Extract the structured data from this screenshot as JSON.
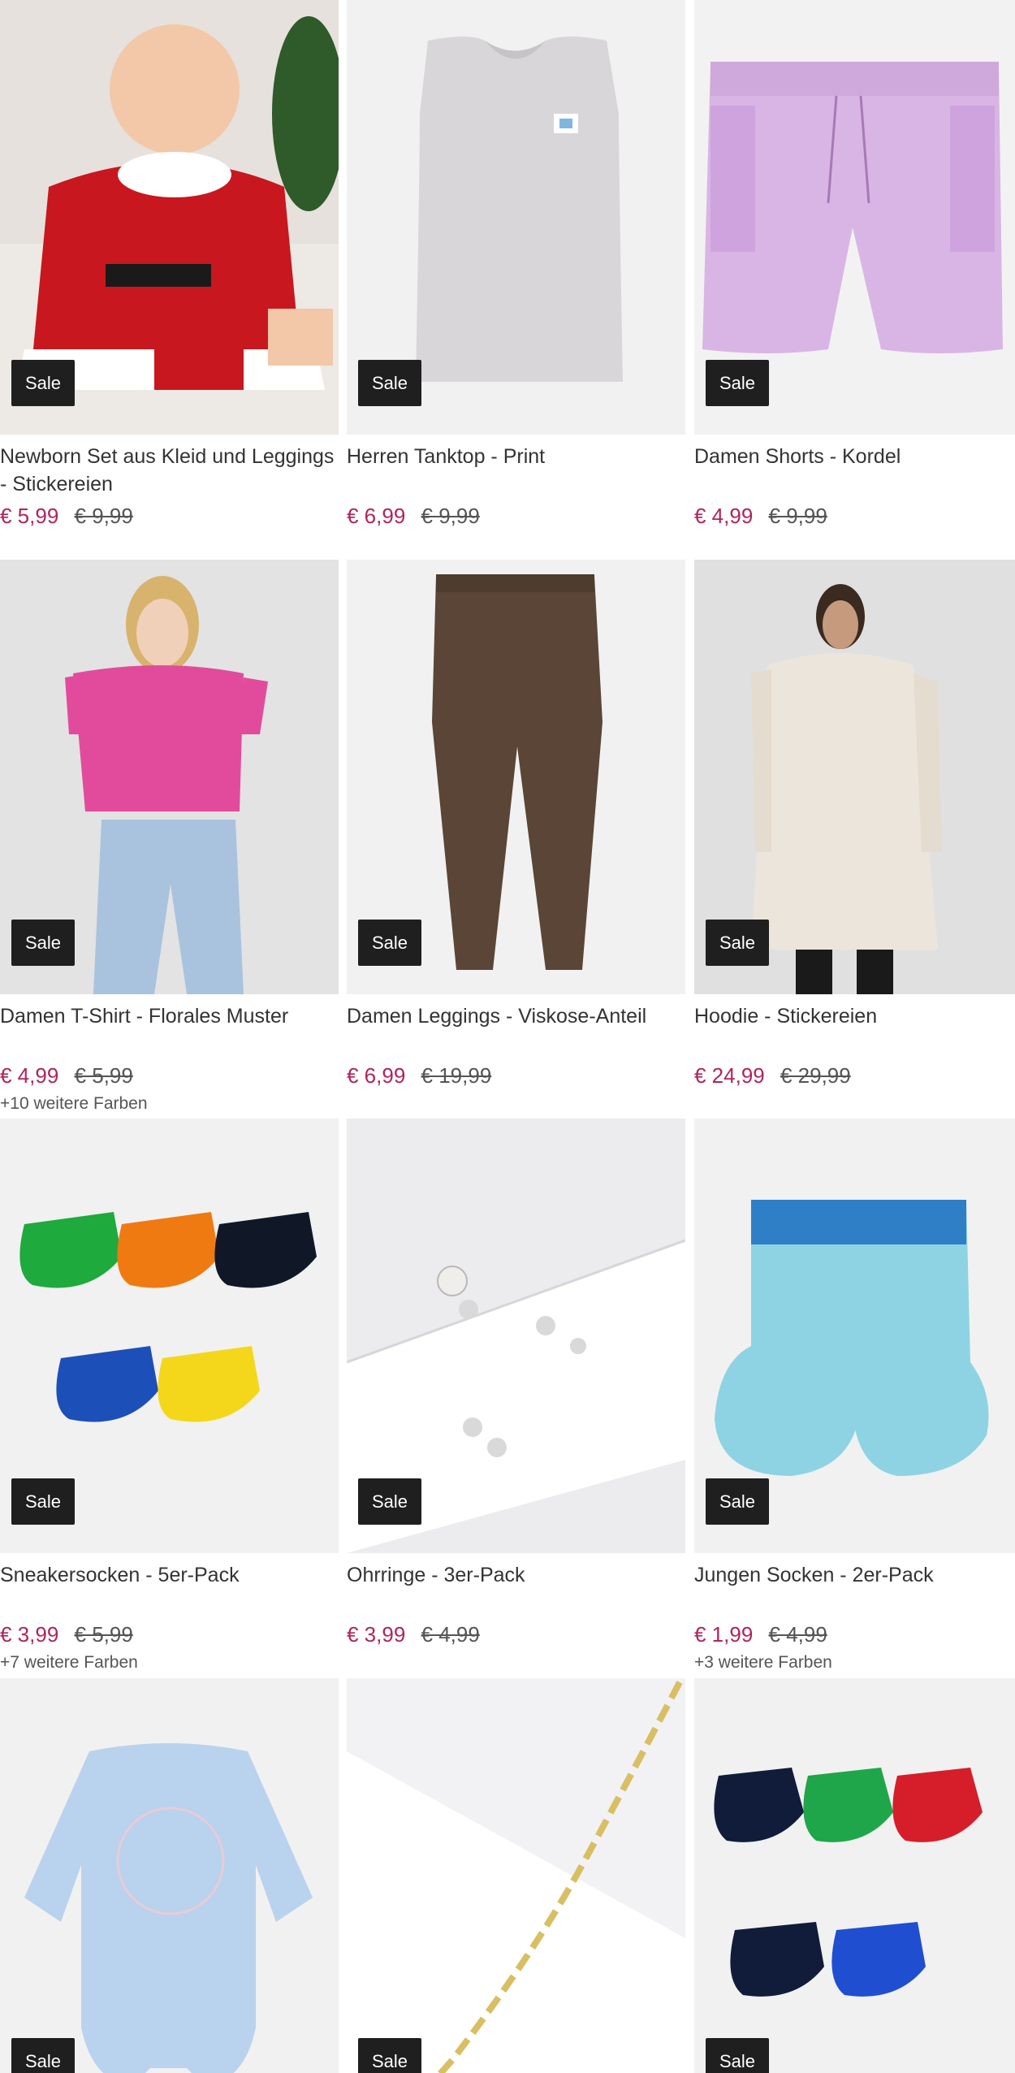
{
  "badge_label": "Sale",
  "colors": {
    "price_sale": "#b0245d",
    "badge_bg": "#1f1f1f"
  },
  "products": [
    {
      "title": "Newborn Set aus Kleid und Leggings - Stickereien",
      "price": "€ 5,99",
      "old_price": "€ 9,99",
      "more_colors": ""
    },
    {
      "title": "Herren Tanktop - Print",
      "price": "€ 6,99",
      "old_price": "€ 9,99",
      "more_colors": ""
    },
    {
      "title": "Damen Shorts - Kordel",
      "price": "€ 4,99",
      "old_price": "€ 9,99",
      "more_colors": ""
    },
    {
      "title": "Damen T-Shirt - Florales Muster",
      "price": "€ 4,99",
      "old_price": "€ 5,99",
      "more_colors": "+10 weitere Farben"
    },
    {
      "title": "Damen Leggings - Viskose-Anteil",
      "price": "€ 6,99",
      "old_price": "€ 19,99",
      "more_colors": ""
    },
    {
      "title": "Hoodie - Stickereien",
      "price": "€ 24,99",
      "old_price": "€ 29,99",
      "more_colors": ""
    },
    {
      "title": "Sneakersocken - 5er-Pack",
      "price": "€ 3,99",
      "old_price": "€ 5,99",
      "more_colors": "+7 weitere Farben"
    },
    {
      "title": "Ohrringe - 3er-Pack",
      "price": "€ 3,99",
      "old_price": "€ 4,99",
      "more_colors": ""
    },
    {
      "title": "Jungen Socken - 2er-Pack",
      "price": "€ 1,99",
      "old_price": "€ 4,99",
      "more_colors": "+3 weitere Farben"
    }
  ]
}
